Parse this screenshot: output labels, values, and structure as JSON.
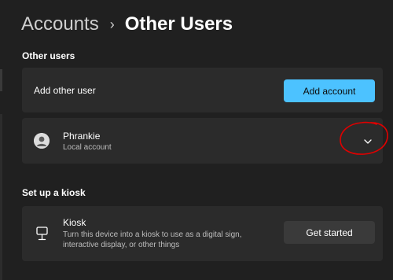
{
  "breadcrumb": {
    "parent": "Accounts",
    "separator": "›",
    "current": "Other Users"
  },
  "other_users_section": {
    "title": "Other users",
    "add_user": {
      "label": "Add other user",
      "button_label": "Add account"
    },
    "users": [
      {
        "name": "Phrankie",
        "type": "Local account",
        "icon": "person-icon"
      }
    ],
    "expand_icon": "chevron-down-icon"
  },
  "kiosk_section": {
    "title": "Set up a kiosk",
    "kiosk": {
      "icon": "kiosk-icon",
      "title": "Kiosk",
      "description": "Turn this device into a kiosk to use as a digital sign, interactive display, or other things",
      "button_label": "Get started"
    }
  },
  "colors": {
    "background": "#202020",
    "card": "#2b2b2b",
    "accent": "#4cc2ff",
    "annotation": "#e00000"
  }
}
